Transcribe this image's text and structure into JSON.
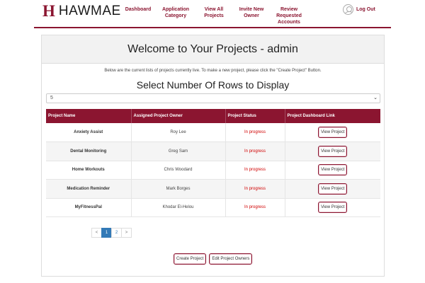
{
  "brand": {
    "mark": "H",
    "name": "HAWMAE"
  },
  "nav": [
    {
      "label": "Dashboard"
    },
    {
      "label": "Application Category"
    },
    {
      "label": "View All Projects"
    },
    {
      "label": "Invite New Owner"
    },
    {
      "label": "Review Requested Accounts"
    }
  ],
  "user": {
    "logout_label": "Log Out"
  },
  "main": {
    "welcome": "Welcome to Your Projects - admin",
    "intro": "Below are the current lists of projects currently live. To make a new project, please click the \"Create Project\" Button.",
    "rows_title": "Select Number Of Rows to Display",
    "rows_selected": "5"
  },
  "table": {
    "headers": [
      "Project Name",
      "Assigned Project Owner",
      "Project Status",
      "Project Dashboard Link"
    ],
    "rows": [
      {
        "name": "Anxiety Assist",
        "owner": "Roy Lee",
        "status": "In progress",
        "link": "View Project"
      },
      {
        "name": "Dental Monitoring",
        "owner": "Greg Sam",
        "status": "In progress",
        "link": "View Project"
      },
      {
        "name": "Home Workouts",
        "owner": "Chris Woodard",
        "status": "In progress",
        "link": "View Project"
      },
      {
        "name": "Medication Reminder",
        "owner": "Mark Borges",
        "status": "In progress",
        "link": "View Project"
      },
      {
        "name": "MyFitnessPal",
        "owner": "Khodar El-Helou",
        "status": "In progress",
        "link": "View Project"
      }
    ]
  },
  "pagination": {
    "prev": "<",
    "pages": [
      "1",
      "2"
    ],
    "next": ">",
    "current": "1"
  },
  "actions": {
    "create_label": "Create Project",
    "edit_owners_label": "Edit Project Owners"
  },
  "colors": {
    "brand": "#8b1530",
    "status": "#d00000",
    "page_active": "#337ab7"
  },
  "icons": {
    "user": "user-circle-icon",
    "select_caret": "chevron-down-icon"
  }
}
